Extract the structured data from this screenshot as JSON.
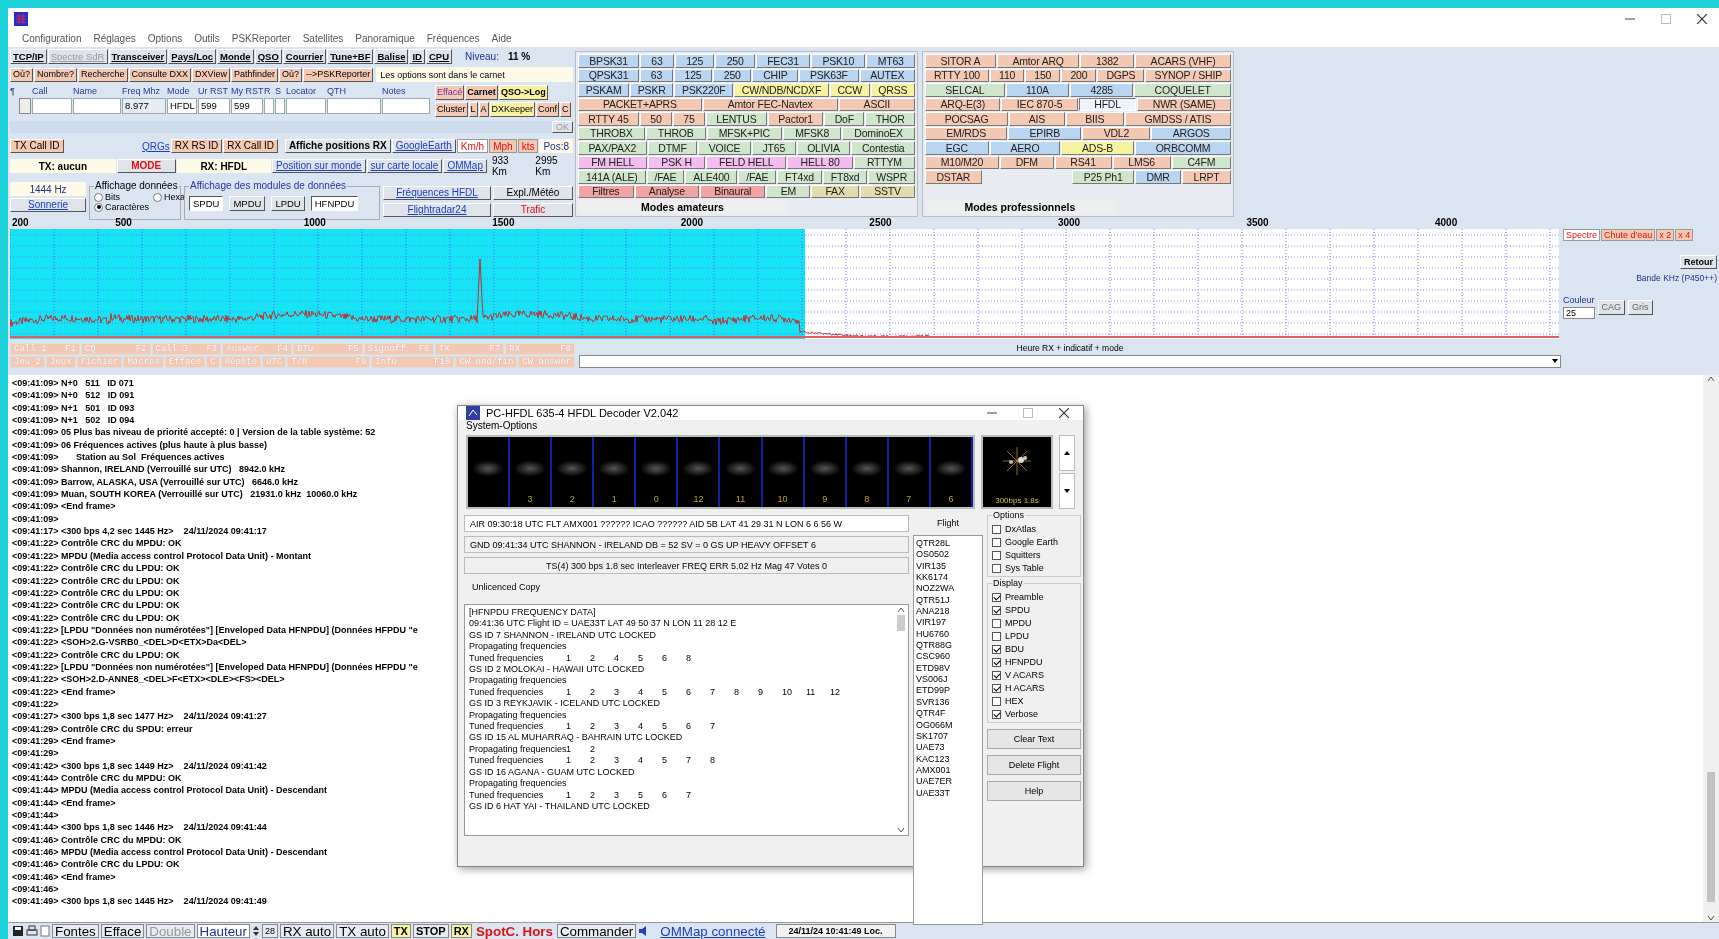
{
  "menu": [
    "Configuration",
    "Réglages",
    "Options",
    "Outils",
    "PSKReporter",
    "Satellites",
    "Panoramique",
    "Fréquences",
    "Aide"
  ],
  "toolbar": {
    "buttons": [
      {
        "label": "TCP/IP",
        "disabled": false
      },
      {
        "label": "Spectre SdR",
        "disabled": true
      },
      {
        "label": "Transceiver",
        "disabled": false
      },
      {
        "label": "Pays/Loc",
        "disabled": false
      },
      {
        "label": "Monde",
        "disabled": false
      },
      {
        "label": "QSO",
        "disabled": false
      },
      {
        "label": "Courrier",
        "disabled": false
      },
      {
        "label": "Tune+BF",
        "disabled": false
      },
      {
        "label": "Balise",
        "disabled": false
      },
      {
        "label": "ID",
        "disabled": false
      },
      {
        "label": "CPU",
        "disabled": false
      }
    ],
    "level_label": "Niveau:",
    "level_value": "11 %"
  },
  "lookup_buttons": [
    "Où?",
    "Nombre?",
    "Recherche",
    "Consulte DXX",
    "DXView",
    "Pathfinder",
    "Où?",
    "-->PSKReporter"
  ],
  "note": "Les options sont dans le carnet",
  "log_entry": {
    "marker": "¶",
    "columns": [
      {
        "header": "Call"
      },
      {
        "header": "Name"
      },
      {
        "header": "Freq Mhz",
        "value": "8.977"
      },
      {
        "header": "Mode",
        "value": "HFDL"
      },
      {
        "header": "Ur RST",
        "value": "599"
      },
      {
        "header": "My RST",
        "value": "599"
      },
      {
        "header": "R"
      },
      {
        "header": "S"
      },
      {
        "header": "Locator"
      },
      {
        "header": "QTH"
      },
      {
        "header": "Notes"
      }
    ],
    "buttons": [
      [
        {
          "label": "Effacé",
          "color": "#f4c9b4"
        },
        {
          "label": "Carnet",
          "color": "#f4c9b4"
        },
        {
          "label": "QSO->Log",
          "color": "#f7f2a0"
        }
      ],
      [
        {
          "label": "Cluster",
          "color": "#f4c9b4"
        },
        {
          "label": "L",
          "color": "#f4c9b4"
        },
        {
          "label": "A",
          "color": "#f4c9b4"
        },
        {
          "label": "DXKeeper",
          "color": "#f7f2a0"
        },
        {
          "label": "Conf",
          "color": "#f4c9b4"
        },
        {
          "label": "C",
          "color": "#f4c9b4"
        }
      ]
    ]
  },
  "ok_button": "OK",
  "tx_panel": {
    "tx_call_id": "TX Call ID",
    "qrgs": "QRGs",
    "rx_rs_id": "RX RS ID",
    "rx_call_id": "RX Call ID",
    "show_positions": "Affiche positions RX",
    "google_earth": "GoogleEarth",
    "units": [
      {
        "label": "Km/h",
        "selected": true
      },
      {
        "label": "Mph",
        "selected": false
      },
      {
        "label": "kts",
        "selected": false
      }
    ],
    "pos": "Pos:8",
    "tx_status": "TX: aucun",
    "mode_button": "MODE",
    "rx_status": "RX: HFDL",
    "world_position": "Position sur monde",
    "local_map": "sur carte locale",
    "ommap": "OMMap",
    "distance_1": "933 Km",
    "distance_2": "2995 Km"
  },
  "data_panel": {
    "frequency": "1444 Hz",
    "ring_button": "Sonnerie",
    "display_group": "Affichage données",
    "radios": [
      {
        "label": "Bits",
        "selected": false
      },
      {
        "label": "Hexa",
        "selected": false
      },
      {
        "label": "Caractères",
        "selected": true
      }
    ],
    "modules_group": "Affichage des modules de données",
    "modules": [
      {
        "label": "SPDU",
        "pressed": true
      },
      {
        "label": "MPDU",
        "pressed": false
      },
      {
        "label": "LPDU",
        "pressed": false
      },
      {
        "label": "HFNPDU",
        "pressed": true
      }
    ],
    "links": [
      {
        "label": "Fréquences HFDL",
        "kind": "link"
      },
      {
        "label": "Expl./Météo",
        "kind": "plain"
      },
      {
        "label": "Flightradar24",
        "kind": "link"
      },
      {
        "label": "Trafic",
        "kind": "alert"
      }
    ]
  },
  "amateur_modes": {
    "title": "Modes amateurs",
    "rows": [
      {
        "buttons": [
          {
            "label": "BPSK31",
            "color": "#b9d5f2",
            "selected": false
          },
          {
            "label": "63",
            "color": "#b9d5f2",
            "selected": false
          },
          {
            "label": "125",
            "color": "#b9d5f2",
            "selected": false
          },
          {
            "label": "250",
            "color": "#b9d5f2",
            "selected": false
          },
          {
            "label": "FEC31",
            "color": "#b9d5f2",
            "selected": false
          },
          {
            "label": "PSK10",
            "color": "#b9d5f2",
            "selected": false
          },
          {
            "label": "MT63",
            "color": "#b9d5f2",
            "selected": false
          }
        ]
      },
      {
        "buttons": [
          {
            "label": "QPSK31",
            "color": "#b9d5f2",
            "selected": false
          },
          {
            "label": "63",
            "color": "#b9d5f2",
            "selected": false
          },
          {
            "label": "125",
            "color": "#b9d5f2",
            "selected": false
          },
          {
            "label": "250",
            "color": "#b9d5f2",
            "selected": false
          },
          {
            "label": "CHIP",
            "color": "#b9d5f2",
            "selected": false
          },
          {
            "label": "PSK63F",
            "color": "#b9d5f2",
            "selected": false
          },
          {
            "label": "AUTEX",
            "color": "#b9d5f2",
            "selected": false
          }
        ]
      },
      {
        "buttons": [
          {
            "label": "PSKAM",
            "color": "#b9d5f2",
            "selected": false
          },
          {
            "label": "PSKR",
            "color": "#b9d5f2",
            "selected": false
          },
          {
            "label": "PSK220F",
            "color": "#b9d5f2",
            "selected": false
          },
          {
            "label": "CW/NDB/NCDXF",
            "color": "#f7f2a0",
            "selected": false
          },
          {
            "label": "CCW",
            "color": "#f7f2a0",
            "selected": false
          },
          {
            "label": "QRSS",
            "color": "#f7f2a0",
            "selected": false
          }
        ]
      },
      {
        "buttons": [
          {
            "label": "PACKET+APRS",
            "color": "#f4c9b4",
            "selected": false
          },
          {
            "label": "Amtor FEC-Navtex",
            "color": "#f4c9b4",
            "selected": false
          },
          {
            "label": "ASCII",
            "color": "#f4c9b4",
            "selected": false
          }
        ]
      },
      {
        "buttons": [
          {
            "label": "RTTY 45",
            "color": "#f4c9b4",
            "selected": false
          },
          {
            "label": "50",
            "color": "#f4c9b4",
            "selected": false
          },
          {
            "label": "75",
            "color": "#f4c9b4",
            "selected": false
          },
          {
            "label": "LENTUS",
            "color": "#cfe6cc",
            "selected": false
          },
          {
            "label": "Pactor1",
            "color": "#f4c9b4",
            "selected": false
          },
          {
            "label": "DoF",
            "color": "#cfe6cc",
            "selected": false
          },
          {
            "label": "THOR",
            "color": "#cfe6cc",
            "selected": false
          }
        ]
      },
      {
        "buttons": [
          {
            "label": "THROBX",
            "color": "#cfe6cc",
            "selected": false
          },
          {
            "label": "THROB",
            "color": "#cfe6cc",
            "selected": false
          },
          {
            "label": "MFSK+PIC",
            "color": "#cfe6cc",
            "selected": false
          },
          {
            "label": "MFSK8",
            "color": "#cfe6cc",
            "selected": false
          },
          {
            "label": "DominoEX",
            "color": "#cfe6cc",
            "selected": false
          }
        ]
      },
      {
        "buttons": [
          {
            "label": "PAX/PAX2",
            "color": "#cfe6cc",
            "selected": false
          },
          {
            "label": "DTMF",
            "color": "#cfe6cc",
            "selected": false
          },
          {
            "label": "VOICE",
            "color": "#cfe6cc",
            "selected": false
          },
          {
            "label": "JT65",
            "color": "#cfe6cc",
            "selected": false
          },
          {
            "label": "OLIVIA",
            "color": "#cfe6cc",
            "selected": false
          },
          {
            "label": "Contestia",
            "color": "#cfe6cc",
            "selected": false
          }
        ]
      },
      {
        "buttons": [
          {
            "label": "FM HELL",
            "color": "#f3bdf0",
            "selected": false
          },
          {
            "label": "PSK H",
            "color": "#f3bdf0",
            "selected": false
          },
          {
            "label": "FELD HELL",
            "color": "#f3bdf0",
            "selected": false
          },
          {
            "label": "HELL 80",
            "color": "#f3bdf0",
            "selected": false
          },
          {
            "label": "RTTYM",
            "color": "#cfe6cc",
            "selected": false
          }
        ]
      },
      {
        "buttons": [
          {
            "label": "141A (ALE)",
            "color": "#cfe6cc",
            "selected": false
          },
          {
            "label": "/FAE",
            "color": "#cfe6cc",
            "selected": false
          },
          {
            "label": "ALE400",
            "color": "#cfe6cc",
            "selected": false
          },
          {
            "label": "/FAE",
            "color": "#cfe6cc",
            "selected": false
          },
          {
            "label": "FT4xd",
            "color": "#cfe6cc",
            "selected": false
          },
          {
            "label": "FT8xd",
            "color": "#cfe6cc",
            "selected": false
          },
          {
            "label": "WSPR",
            "color": "#cfe6cc",
            "selected": false
          }
        ]
      },
      {
        "buttons": [
          {
            "label": "Filtres",
            "color": "#f2a3a3",
            "selected": false
          },
          {
            "label": "Analyse",
            "color": "#f2a3a3",
            "selected": false
          },
          {
            "label": "Binaural",
            "color": "#f2a3a3",
            "selected": false
          },
          {
            "label": "EM",
            "color": "#cfe6cc",
            "selected": false
          },
          {
            "label": "FAX",
            "color": "#e3dcae",
            "selected": false
          },
          {
            "label": "SSTV",
            "color": "#e3dcae",
            "selected": false
          }
        ]
      }
    ]
  },
  "professional_modes": {
    "title": "Modes professionnels",
    "rows": [
      {
        "buttons": [
          {
            "label": "SITOR A",
            "color": "#f4c9b4",
            "selected": false
          },
          {
            "label": "Amtor ARQ",
            "color": "#f4c9b4",
            "selected": false
          },
          {
            "label": "1382",
            "color": "#f4c9b4",
            "selected": false
          },
          {
            "label": "ACARS (VHF)",
            "color": "#f4c9b4",
            "selected": false
          }
        ]
      },
      {
        "buttons": [
          {
            "label": "RTTY 100",
            "color": "#f4c9b4",
            "selected": false
          },
          {
            "label": "110",
            "color": "#f4c9b4",
            "selected": false
          },
          {
            "label": "150",
            "color": "#f4c9b4",
            "selected": false
          },
          {
            "label": "200",
            "color": "#f4c9b4",
            "selected": false
          },
          {
            "label": "DGPS",
            "color": "#f4c9b4",
            "selected": false
          },
          {
            "label": "SYNOP / SHIP",
            "color": "#f4c9b4",
            "selected": false
          }
        ]
      },
      {
        "buttons": [
          {
            "label": "SELCAL",
            "color": "#cfe6cc",
            "selected": false
          },
          {
            "label": "110A",
            "color": "#b9d5f2",
            "selected": false
          },
          {
            "label": "4285",
            "color": "#b9d5f2",
            "selected": false
          },
          {
            "label": "COQUELET",
            "color": "#cfe6cc",
            "selected": false
          }
        ]
      },
      {
        "buttons": [
          {
            "label": "ARQ-E(3)",
            "color": "#f4c9b4",
            "selected": false
          },
          {
            "label": "IEC 870-5",
            "color": "#f4c9b4",
            "selected": false
          },
          {
            "label": "HFDL",
            "color": "#eef4fb",
            "selected": true
          },
          {
            "label": "NWR (SAME)",
            "color": "#f4c9b4",
            "selected": false
          }
        ]
      },
      {
        "buttons": [
          {
            "label": "POCSAG",
            "color": "#f4c9b4",
            "selected": false
          },
          {
            "label": "AIS",
            "color": "#f4c9b4",
            "selected": false
          },
          {
            "label": "BIIS",
            "color": "#f4c9b4",
            "selected": false
          },
          {
            "label": "GMDSS / ATIS",
            "color": "#f4c9b4",
            "selected": false
          }
        ]
      },
      {
        "buttons": [
          {
            "label": "EM/RDS",
            "color": "#f4c9b4",
            "selected": false
          },
          {
            "label": "EPIRB",
            "color": "#b9d5f2",
            "selected": false
          },
          {
            "label": "VDL2",
            "color": "#f4c9b4",
            "selected": false
          },
          {
            "label": "ARGOS",
            "color": "#b9d5f2",
            "selected": false
          }
        ]
      },
      {
        "buttons": [
          {
            "label": "EGC",
            "color": "#b9d5f2",
            "selected": false
          },
          {
            "label": "AERO",
            "color": "#b9d5f2",
            "selected": false
          },
          {
            "label": "ADS-B",
            "color": "#f7f2a0",
            "selected": false
          },
          {
            "label": "ORBCOMM",
            "color": "#b9d5f2",
            "selected": false
          }
        ]
      },
      {
        "buttons": [
          {
            "label": "M10/M20",
            "color": "#f4c9b4",
            "selected": false
          },
          {
            "label": "DFM",
            "color": "#f4c9b4",
            "selected": false
          },
          {
            "label": "RS41",
            "color": "#f4c9b4",
            "selected": false
          },
          {
            "label": "LMS6",
            "color": "#f4c9b4",
            "selected": false
          },
          {
            "label": "C4FM",
            "color": "#cfe6cc",
            "selected": false
          }
        ]
      },
      {
        "buttons": [
          {
            "label": "DSTAR",
            "color": "#f4c9b4",
            "selected": false
          },
          {
            "label": "P25 Ph1",
            "color": "#cfe6cc",
            "selected": false
          },
          {
            "label": "DMR",
            "color": "#b9d5f2",
            "selected": false
          },
          {
            "label": "LRPT",
            "color": "#f4c9b4",
            "selected": false
          }
        ]
      }
    ]
  },
  "spectrum": {
    "scale": [
      "200",
      "500",
      "1000",
      "1500",
      "2000",
      "2500",
      "3000",
      "3500",
      "4000"
    ],
    "tabs": [
      {
        "label": "Spectre",
        "selected": true
      },
      {
        "label": "Chute d'eau",
        "selected": false
      },
      {
        "label": "x 2",
        "selected": false
      },
      {
        "label": "x 4",
        "selected": false
      }
    ],
    "back_button": "Retour",
    "band_label": "Bande KHz (P450++)",
    "color_label": "Couleur",
    "color_value": "25",
    "buttons": [
      "CAG",
      "Gris"
    ]
  },
  "macros": [
    [
      {
        "label": "Call 1",
        "key": "F1"
      },
      {
        "label": "CQ",
        "key": "F2"
      },
      {
        "label": "Call 3",
        "key": "F3"
      },
      {
        "label": "Answer",
        "key": "F4"
      },
      {
        "label": "BTU",
        "key": "F5"
      },
      {
        "label": "Signoff",
        "key": "F6"
      },
      {
        "label": "TX",
        "key": "F7"
      },
      {
        "label": "RX",
        "key": "F8"
      }
    ],
    [
      {
        "label": "Jeu 2"
      },
      {
        "label": "Jeux"
      },
      {
        "label": "Fichier"
      },
      {
        "label": "Macros"
      },
      {
        "label": "Efface"
      },
      {
        "label": "C"
      },
      {
        "label": "Répète"
      },
      {
        "label": "UTC"
      },
      {
        "label": "T/R",
        "key": "F9"
      },
      {
        "label": "Info",
        "key": "F10"
      },
      {
        "label": "CW end/fin"
      },
      {
        "label": "CW answer"
      }
    ]
  ],
  "history": {
    "label": "Heure RX + indicatif + mode"
  },
  "log": [
    "<09:41:09> N+0   511   ID 071",
    "<09:41:09> N+0   512   ID 091",
    "<09:41:09> N+1   501   ID 093",
    "<09:41:09> N+1   502   ID 094",
    "<09:41:09> 05 Plus bas niveau de priorité accepté: 0 | Version de la table système: 52",
    "<09:41:09> 06 Fréquences actives (plus haute à plus basse)",
    "<09:41:09>       Station au Sol  Fréquences actives",
    "<09:41:09> Shannon, IRELAND (Verrouillé sur UTC)   8942.0 kHz",
    "<09:41:09> Barrow, ALASKA, USA (Verrouillé sur UTC)   6646.0 kHz",
    "<09:41:09> Muan, SOUTH KOREA (Verrouillé sur UTC)   21931.0 kHz  10060.0 kHz",
    "<09:41:09> <End frame>",
    "<09:41:09>",
    "<09:41:17> <300 bps 4,2 sec 1445 Hz>    24/11/2024 09:41:17",
    "<09:41:22> Contrôle CRC du MPDU: OK",
    "<09:41:22> MPDU (Media access control Protocol Data Unit) - Montant",
    "<09:41:22> Contrôle CRC du LPDU: OK",
    "<09:41:22> Contrôle CRC du LPDU: OK",
    "<09:41:22> Contrôle CRC du LPDU: OK",
    "<09:41:22> Contrôle CRC du LPDU: OK",
    "<09:41:22> Contrôle CRC du LPDU: OK",
    "<09:41:22> [LPDU \"Données non numérotées\"] [Enveloped Data HFNPDU] (Données HFPDU \"e",
    "<09:41:22> <SOH>2.G-VSRB0_<DEL>D<ETX>Da<DEL>",
    "<09:41:22> Contrôle CRC du LPDU: OK",
    "<09:41:22> [LPDU \"Données non numérotées\"] [Enveloped Data HFNPDU] (Données HFPDU \"e",
    "<09:41:22> <SOH>2.D-ANNE8_<DEL>F<ETX><DLE><FS><DEL>",
    "<09:41:22> <End frame>",
    "<09:41:22>",
    "<09:41:27> <300 bps 1,8 sec 1477 Hz>    24/11/2024 09:41:27",
    "<09:41:29> Contrôle CRC du SPDU: erreur",
    "<09:41:29> <End frame>",
    "<09:41:29>",
    "<09:41:42> <300 bps 1,8 sec 1449 Hz>    24/11/2024 09:41:42",
    "<09:41:44> Contrôle CRC du MPDU: OK",
    "<09:41:44> MPDU (Media access control Protocol Data Unit) - Descendant",
    "<09:41:44> <End frame>",
    "<09:41:44>",
    "<09:41:44> <300 bps 1,8 sec 1446 Hz>    24/11/2024 09:41:44",
    "<09:41:46> Contrôle CRC du MPDU: OK",
    "<09:41:46> MPDU (Media access control Protocol Data Unit) - Descendant",
    "<09:41:46> Contrôle CRC du LPDU: OK",
    "<09:41:46> <End frame>",
    "<09:41:46>",
    "<09:41:49> <300 bps 1,8 sec 1445 Hz>    24/11/2024 09:41:49"
  ],
  "decoder": {
    "title": "PC-HFDL 635-4 HFDL Decoder V2.042",
    "menu": "System-Options",
    "slots": [
      "3",
      "2",
      "1",
      "0",
      "12",
      "11",
      "10",
      "9",
      "8",
      "7",
      "6"
    ],
    "constellation_label": "300bps 1.8s",
    "air": "AIR 09:30:18  UTC FLT AMX001 ?????? ICAO ?????? AID 5B LAT 41 29 31  N  LON 6 6 56  W",
    "gnd": "GND 09:41:34 UTC SHANNON - IRELAND  DB = 52  SV = 0  GS UP HEAVY   OFFSET 6",
    "ts": "TS(4) 300  bps 1.8 sec Interleaver FREQ ERR 5.02 Hz Mag 47 Votes 0",
    "license": "Unlicenced Copy",
    "text": [
      {
        "text": "[HFNPDU FREQUENCY DATA]"
      },
      {
        "text": "09:41:36  UTC  Flight ID = UAE33T  LAT 49 50 37  N  LON 11 28 12  E"
      },
      {
        "text": "GS ID 7 SHANNON - IRELAND UTC LOCKED"
      },
      {
        "text": "Propagating frequencies"
      },
      {
        "text": "Tuned frequencies",
        "numbers": [
          "1",
          "2",
          "4",
          "5",
          "6",
          "8"
        ]
      },
      {
        "text": "GS ID 2 MOLOKAI - HAWAII UTC LOCKED"
      },
      {
        "text": "Propagating frequencies"
      },
      {
        "text": "Tuned frequencies",
        "numbers": [
          "1",
          "2",
          "3",
          "4",
          "5",
          "6",
          "7",
          "8",
          "9",
          "10",
          "11",
          "12"
        ]
      },
      {
        "text": "GS ID 3 REYKJAVIK - ICELAND UTC LOCKED"
      },
      {
        "text": "Propagating frequencies"
      },
      {
        "text": "Tuned frequencies",
        "numbers": [
          "1",
          "2",
          "3",
          "4",
          "5",
          "6",
          "7"
        ]
      },
      {
        "text": "GS ID 15 AL MUHARRAQ - BAHRAIN UTC LOCKED"
      },
      {
        "text": "Propagating frequencies",
        "numbers": [
          "1",
          "2"
        ]
      },
      {
        "text": "Tuned frequencies",
        "numbers": [
          "1",
          "2",
          "3",
          "4",
          "5",
          "7",
          "8"
        ]
      },
      {
        "text": "GS ID 16 AGANA - GUAM UTC LOCKED"
      },
      {
        "text": "Propagating frequencies"
      },
      {
        "text": "Tuned frequencies",
        "numbers": [
          "1",
          "2",
          "3",
          "5",
          "6",
          "7"
        ]
      },
      {
        "text": "GS ID 6 HAT YAI - THAILAND UTC LOCKED"
      }
    ],
    "flight_label": "Flight",
    "flights": [
      "QTR28L",
      "OS0502",
      "VIR135",
      "KK6174",
      "NOZ2WA",
      "QTR51J",
      "ANA218",
      "VIR197",
      "HU6760",
      "QTR88G",
      "CSC960",
      "ETD98V",
      "VS006J",
      "ETD99P",
      "SVR136",
      "QTR4F",
      "OG066M",
      "SK1707",
      "UAE73",
      "KAC123",
      "AMX001",
      "UAE7ER",
      "UAE33T"
    ],
    "options_label": "Options",
    "options": [
      {
        "label": "DxAtlas",
        "checked": false
      },
      {
        "label": "Google Earth",
        "checked": false
      },
      {
        "label": "Squitters",
        "checked": false
      },
      {
        "label": "Sys Table",
        "checked": false
      }
    ],
    "display_label": "Display",
    "display": [
      {
        "label": "Preamble",
        "checked": true
      },
      {
        "label": "SPDU",
        "checked": true
      },
      {
        "label": "MPDU",
        "checked": false
      },
      {
        "label": "LPDU",
        "checked": false
      },
      {
        "label": "BDU",
        "checked": true
      },
      {
        "label": "HFNPDU",
        "checked": true
      },
      {
        "label": "V ACARS",
        "checked": true
      },
      {
        "label": "H ACARS",
        "checked": true
      },
      {
        "label": "HEX",
        "checked": false
      },
      {
        "label": "Verbose",
        "checked": true
      }
    ],
    "buttons": [
      "Clear Text",
      "Delete Flight",
      "Help"
    ]
  },
  "status_bar": [
    {
      "label": "Fontes",
      "kind": "button"
    },
    {
      "label": "Efface",
      "kind": "button"
    },
    {
      "label": "Double",
      "kind": "faded"
    },
    {
      "label": "Hauteur",
      "kind": "spin"
    },
    {
      "label": "28",
      "kind": "value"
    },
    {
      "label": "RX auto",
      "kind": "button"
    },
    {
      "label": "TX auto",
      "kind": "button"
    },
    {
      "label": "TX",
      "kind": "yellow"
    },
    {
      "label": "STOP",
      "kind": "strong"
    },
    {
      "label": "RX",
      "kind": "yellow"
    },
    {
      "label": "SpotC. Hors",
      "kind": "alert"
    },
    {
      "label": "Commander",
      "kind": "button"
    },
    {
      "label": "OMMap connecté",
      "kind": "link"
    },
    {
      "label": "24/11/24 10:41:49 Loc.",
      "kind": "clock"
    }
  ]
}
